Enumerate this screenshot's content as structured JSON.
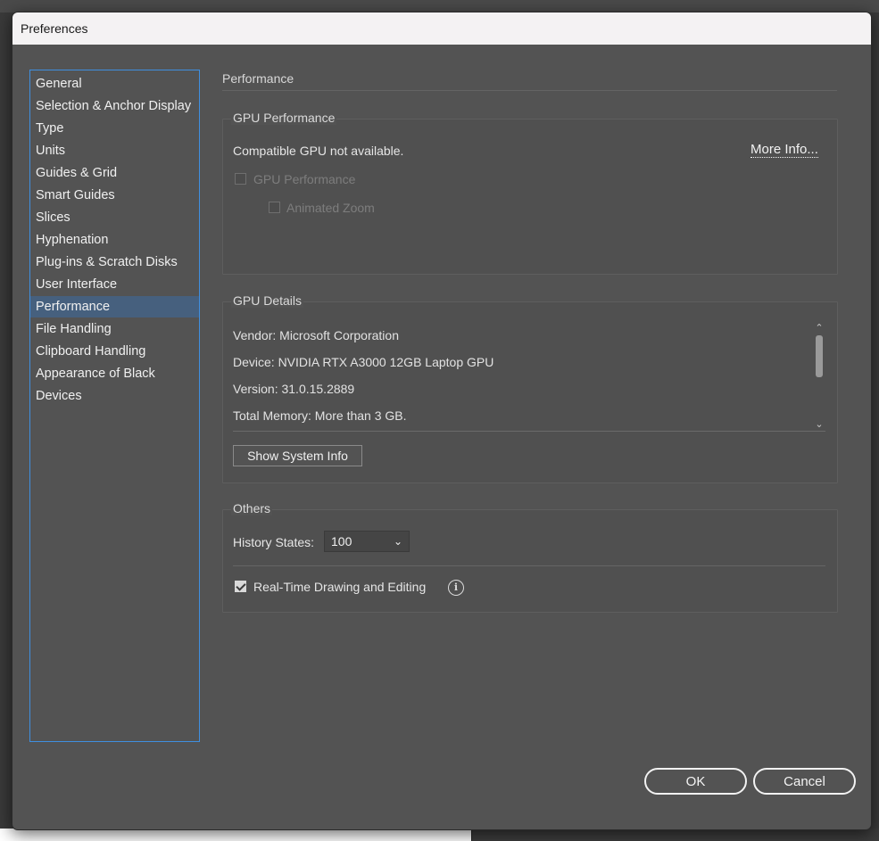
{
  "window": {
    "title": "Preferences"
  },
  "sidebar": {
    "items": [
      {
        "label": "General"
      },
      {
        "label": "Selection & Anchor Display"
      },
      {
        "label": "Type"
      },
      {
        "label": "Units"
      },
      {
        "label": "Guides & Grid"
      },
      {
        "label": "Smart Guides"
      },
      {
        "label": "Slices"
      },
      {
        "label": "Hyphenation"
      },
      {
        "label": "Plug-ins & Scratch Disks"
      },
      {
        "label": "User Interface"
      },
      {
        "label": "Performance"
      },
      {
        "label": "File Handling"
      },
      {
        "label": "Clipboard Handling"
      },
      {
        "label": "Appearance of Black"
      },
      {
        "label": "Devices"
      }
    ],
    "selected_label": "Performance"
  },
  "main": {
    "section_title": "Performance",
    "gpu_performance": {
      "legend": "GPU Performance",
      "status_text": "Compatible GPU not available.",
      "more_info_link": "More Info...",
      "gpu_checkbox_label": "GPU Performance",
      "gpu_checkbox_checked": false,
      "animated_zoom_label": "Animated Zoom",
      "animated_zoom_checked": false
    },
    "gpu_details": {
      "legend": "GPU Details",
      "vendor": "Vendor: Microsoft Corporation",
      "device": "Device: NVIDIA RTX A3000 12GB Laptop GPU",
      "version": "Version: 31.0.15.2889",
      "total_memory": "Total Memory:  More than 3 GB.",
      "show_system_info_button": "Show System Info"
    },
    "others": {
      "legend": "Others",
      "history_states_label": "History States:",
      "history_states_value": "100",
      "realtime_label": "Real-Time Drawing and Editing",
      "realtime_checked": true
    }
  },
  "footer": {
    "ok_label": "OK",
    "cancel_label": "Cancel"
  },
  "colors": {
    "dialog_bg": "#535353",
    "selection": "#46607e",
    "list_border": "#3f8fe0"
  }
}
